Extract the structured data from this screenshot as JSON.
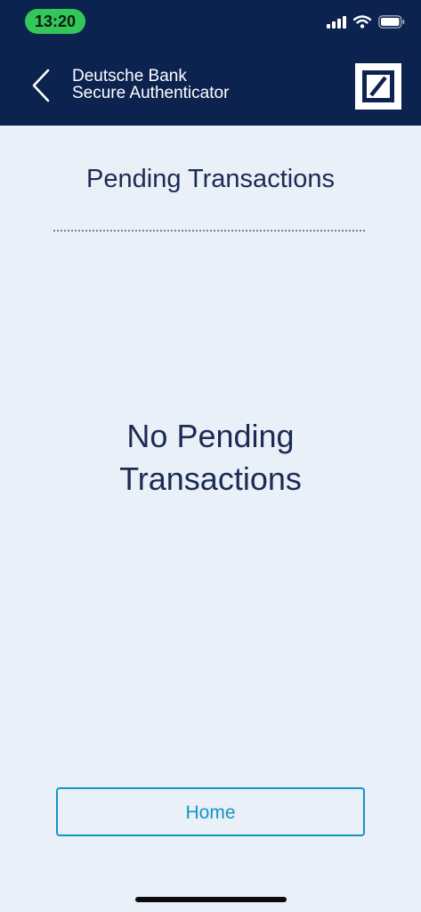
{
  "status_bar": {
    "time": "13:20",
    "icons": [
      "cellular-signal-icon",
      "wifi-icon",
      "battery-icon"
    ]
  },
  "header": {
    "title_line1": "Deutsche Bank",
    "title_line2": "Secure Authenticator",
    "back_icon": "chevron-left-icon",
    "logo": "deutsche-bank-logo"
  },
  "main": {
    "title": "Pending Transactions",
    "empty_line1": "No Pending",
    "empty_line2": "Transactions"
  },
  "footer": {
    "home_label": "Home"
  },
  "colors": {
    "header_bg": "#0c2350",
    "page_bg": "#e9f0f7",
    "text_dark": "#1c2a55",
    "accent": "#1493c8",
    "status_pill": "#33c75a"
  }
}
